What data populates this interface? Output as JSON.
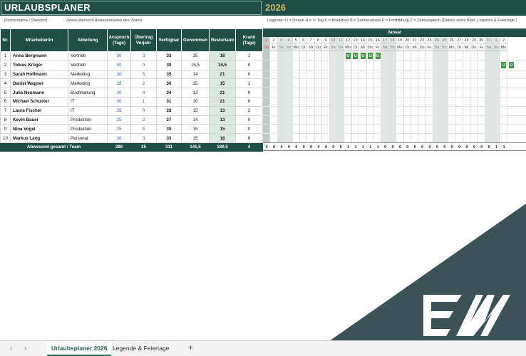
{
  "title": "URLAUBSPLANER",
  "year": "2026",
  "company_placeholder": "[Firmenname / Standort]",
  "subtitle": "Jahresübersicht Abwesenheiten des Teams",
  "legend": "Legende:  U = Urlaub   H = ½ Tag   K = Krankheit   S = Sonderurlaub   F = Fortbildung   Z = Zeitausgleich   (Details siehe Blatt „Legende & Feiertage“)",
  "columns": [
    "Nr.",
    "Mitarbeiter/in",
    "Abteilung",
    "Anspruch (Tage)",
    "Übertrag Vorjahr",
    "Verfügbar",
    "Genommen",
    "Resturlaub",
    "Krank (Tage)"
  ],
  "employees": [
    {
      "nr": "1",
      "name": "Anna Bergmann",
      "dept": "Vertrieb",
      "anspruch": "30",
      "uebertrag": "3",
      "verfuegbar": "33",
      "genommen": "15",
      "rest": "18",
      "krank": "1"
    },
    {
      "nr": "2",
      "name": "Tobias Krüger",
      "dept": "Vertrieb",
      "anspruch": "30",
      "uebertrag": "0",
      "verfuegbar": "30",
      "genommen": "15,5",
      "rest": "14,5",
      "krank": "0"
    },
    {
      "nr": "3",
      "name": "Sarah Hoffmann",
      "dept": "Marketing",
      "anspruch": "30",
      "uebertrag": "5",
      "verfuegbar": "35",
      "genommen": "14",
      "rest": "21",
      "krank": "0"
    },
    {
      "nr": "4",
      "name": "Daniel Wagner",
      "dept": "Marketing",
      "anspruch": "28",
      "uebertrag": "2",
      "verfuegbar": "30",
      "genommen": "15",
      "rest": "15",
      "krank": "1"
    },
    {
      "nr": "5",
      "name": "Julia Neumann",
      "dept": "Buchhaltung",
      "anspruch": "30",
      "uebertrag": "4",
      "verfuegbar": "34",
      "genommen": "13",
      "rest": "21",
      "krank": "0"
    },
    {
      "nr": "6",
      "name": "Michael Schuster",
      "dept": "IT",
      "anspruch": "30",
      "uebertrag": "1",
      "verfuegbar": "31",
      "genommen": "10",
      "rest": "21",
      "krank": "0"
    },
    {
      "nr": "7",
      "name": "Laura Fischer",
      "dept": "IT",
      "anspruch": "28",
      "uebertrag": "0",
      "verfuegbar": "28",
      "genommen": "15",
      "rest": "13",
      "krank": "2"
    },
    {
      "nr": "8",
      "name": "Kevin Bauer",
      "dept": "Produktion",
      "anspruch": "25",
      "uebertrag": "2",
      "verfuegbar": "27",
      "genommen": "14",
      "rest": "13",
      "krank": "0"
    },
    {
      "nr": "9",
      "name": "Nina Vogel",
      "dept": "Produktion",
      "anspruch": "25",
      "uebertrag": "5",
      "verfuegbar": "30",
      "genommen": "15",
      "rest": "15",
      "krank": "0"
    },
    {
      "nr": "10",
      "name": "Markus Lang",
      "dept": "Personal",
      "anspruch": "30",
      "uebertrag": "3",
      "verfuegbar": "33",
      "genommen": "15",
      "rest": "18",
      "krank": "0"
    }
  ],
  "totals": {
    "label": "Abwesend gesamt / Team",
    "anspruch": "286",
    "uebertrag": "25",
    "verfuegbar": "311",
    "genommen": "141,5",
    "rest": "169,5",
    "krank": "4"
  },
  "calendar": {
    "month": "Januar",
    "days": [
      {
        "d": "1",
        "wd": "Do",
        "type": "holiday"
      },
      {
        "d": "2",
        "wd": "Fr",
        "type": ""
      },
      {
        "d": "3",
        "wd": "Sa",
        "type": "weekend"
      },
      {
        "d": "4",
        "wd": "So",
        "type": "weekend"
      },
      {
        "d": "5",
        "wd": "Mo",
        "type": ""
      },
      {
        "d": "6",
        "wd": "Di",
        "type": ""
      },
      {
        "d": "7",
        "wd": "Mi",
        "type": ""
      },
      {
        "d": "8",
        "wd": "Do",
        "type": ""
      },
      {
        "d": "9",
        "wd": "Fr",
        "type": ""
      },
      {
        "d": "10",
        "wd": "Sa",
        "type": "weekend"
      },
      {
        "d": "11",
        "wd": "So",
        "type": "weekend"
      },
      {
        "d": "12",
        "wd": "Mo",
        "type": ""
      },
      {
        "d": "13",
        "wd": "Di",
        "type": ""
      },
      {
        "d": "14",
        "wd": "Mi",
        "type": ""
      },
      {
        "d": "15",
        "wd": "Do",
        "type": ""
      },
      {
        "d": "16",
        "wd": "Fr",
        "type": ""
      },
      {
        "d": "17",
        "wd": "Sa",
        "type": "weekend"
      },
      {
        "d": "18",
        "wd": "So",
        "type": "weekend"
      },
      {
        "d": "19",
        "wd": "Mo",
        "type": ""
      },
      {
        "d": "20",
        "wd": "Di",
        "type": ""
      },
      {
        "d": "21",
        "wd": "Mi",
        "type": ""
      },
      {
        "d": "22",
        "wd": "Do",
        "type": ""
      },
      {
        "d": "23",
        "wd": "Fr",
        "type": ""
      },
      {
        "d": "24",
        "wd": "Sa",
        "type": "weekend"
      },
      {
        "d": "25",
        "wd": "So",
        "type": "weekend"
      },
      {
        "d": "26",
        "wd": "Mo",
        "type": ""
      },
      {
        "d": "27",
        "wd": "Di",
        "type": ""
      },
      {
        "d": "28",
        "wd": "Mi",
        "type": ""
      },
      {
        "d": "29",
        "wd": "Do",
        "type": ""
      },
      {
        "d": "30",
        "wd": "Fr",
        "type": ""
      },
      {
        "d": "31",
        "wd": "Sa",
        "type": "weekend"
      },
      {
        "d": "1",
        "wd": "So",
        "type": "weekend"
      },
      {
        "d": "2",
        "wd": "Mo",
        "type": ""
      }
    ],
    "day_totals": [
      "0",
      "0",
      "0",
      "0",
      "0",
      "0",
      "0",
      "0",
      "0",
      "0",
      "0",
      "1",
      "1",
      "1",
      "1",
      "1",
      "0",
      "0",
      "0",
      "0",
      "0",
      "0",
      "0",
      "0",
      "0",
      "0",
      "0",
      "0",
      "0",
      "0",
      "0",
      "1",
      "1"
    ],
    "entries": [
      {
        "row": 0,
        "day": 11,
        "code": "U"
      },
      {
        "row": 0,
        "day": 12,
        "code": "U"
      },
      {
        "row": 0,
        "day": 13,
        "code": "U"
      },
      {
        "row": 0,
        "day": 14,
        "code": "U"
      },
      {
        "row": 0,
        "day": 15,
        "code": "U"
      },
      {
        "row": 1,
        "day": 32,
        "code": "U"
      },
      {
        "row": 1,
        "day": 33,
        "code": "U"
      }
    ]
  },
  "sheet_tabs": [
    "Urlaubsplaner 2026",
    "Legende & Feiertage"
  ],
  "active_tab": 0,
  "colors": {
    "header": "#1f4e47",
    "accent_year": "#c9b66a",
    "vacation": "#3a9a3c",
    "rest_bg": "#d9ebe0",
    "overlay": "#3b5358"
  },
  "icons": [
    "chevron-left-icon",
    "chevron-right-icon",
    "add-sheet-icon",
    "ew-logo"
  ]
}
